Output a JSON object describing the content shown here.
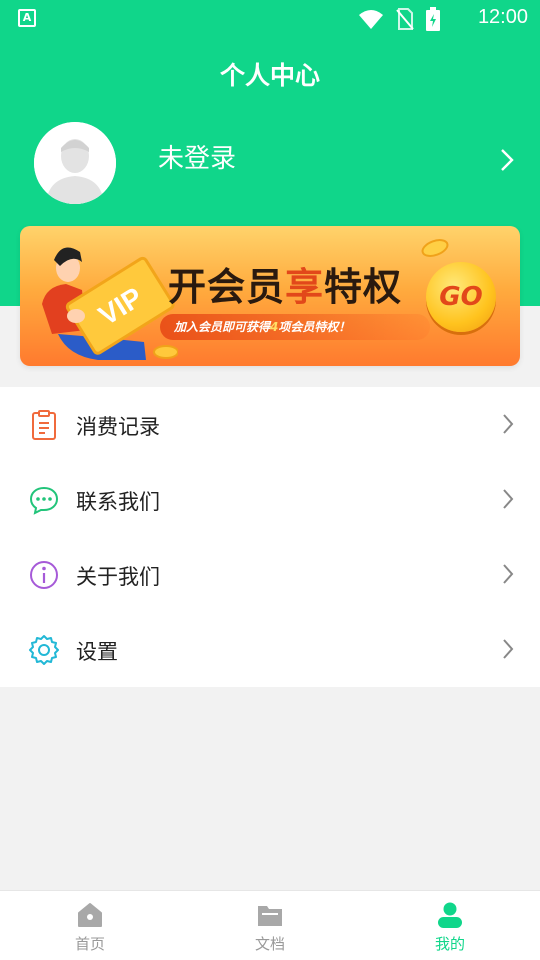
{
  "status_bar": {
    "left_indicator": "A",
    "time": "12:00"
  },
  "header": {
    "title": "个人中心",
    "login_text": "未登录"
  },
  "vip_banner": {
    "badge_text": "VIP",
    "title_part1": "开会员",
    "title_highlight": "享",
    "title_part2": "特权",
    "subtitle_prefix": "加入会员即可获得",
    "subtitle_number": "4",
    "subtitle_suffix": "项会员特权！",
    "go_label": "GO"
  },
  "menu": {
    "items": [
      {
        "label": "消费记录",
        "icon": "clipboard-icon",
        "color": "#f06a3c"
      },
      {
        "label": "联系我们",
        "icon": "chat-icon",
        "color": "#22c47a"
      },
      {
        "label": "关于我们",
        "icon": "info-icon",
        "color": "#a65ad8"
      },
      {
        "label": "设置",
        "icon": "gear-icon",
        "color": "#22b8d6"
      }
    ]
  },
  "bottom_nav": {
    "items": [
      {
        "label": "首页",
        "icon": "home-icon"
      },
      {
        "label": "文档",
        "icon": "folder-icon"
      },
      {
        "label": "我的",
        "icon": "user-icon",
        "active": true
      }
    ]
  },
  "colors": {
    "brand_green": "#10d68a",
    "banner_orange": "#ff7a2e",
    "inactive_gray": "#999999"
  }
}
